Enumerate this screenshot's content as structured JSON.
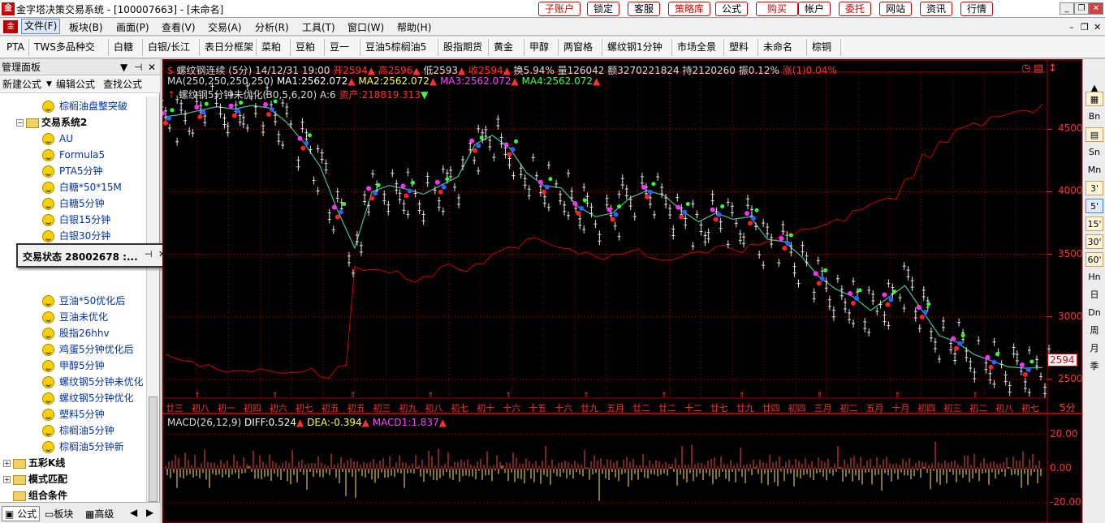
{
  "window": {
    "title": "金字塔决策交易系统 - [100007663] - [未命名]",
    "app_icon": "pyramid-logo-icon",
    "top_buttons": [
      "子账户",
      "锁定",
      "客服",
      "策略库",
      "公式",
      "购买",
      "帐户",
      "委托",
      "网站",
      "资讯",
      "行情"
    ],
    "red_buttons": [
      "子账户",
      "策略库",
      "购买",
      "委托"
    ]
  },
  "menu": {
    "items": [
      "文件(F)",
      "板块(B)",
      "画面(P)",
      "查看(V)",
      "交易(A)",
      "分析(R)",
      "工具(T)",
      "窗口(W)",
      "帮助(H)"
    ]
  },
  "tabs": [
    "PTA",
    "TWS多品种交",
    "白糖",
    "白银/长江",
    "表日分框架",
    "菜粕",
    "豆粕",
    "豆一",
    "豆油5棕榈油5",
    "股指期货",
    "黄金",
    "甲醇",
    "两窗格",
    "螺纹钢1分钟",
    "市场全景",
    "塑料",
    "未命名",
    "棕铜"
  ],
  "left_panel": {
    "title": "管理面板",
    "tools": [
      "新建公式",
      "编辑公式",
      "查找公式"
    ],
    "tree": [
      {
        "label": "棕榈油盘整突破",
        "type": "formula"
      },
      {
        "label": "交易系统2",
        "type": "folder"
      },
      {
        "label": "AU",
        "type": "formula"
      },
      {
        "label": "Formula5",
        "type": "formula"
      },
      {
        "label": "PTA5分钟",
        "type": "formula"
      },
      {
        "label": "白糖*50*15M",
        "type": "formula"
      },
      {
        "label": "白糖5分钟",
        "type": "formula"
      },
      {
        "label": "白银15分钟",
        "type": "formula"
      },
      {
        "label": "白银30分钟",
        "type": "formula"
      },
      {
        "label": "豆油*50优化后",
        "type": "formula"
      },
      {
        "label": "豆油未优化",
        "type": "formula"
      },
      {
        "label": "股指26hhv",
        "type": "formula"
      },
      {
        "label": "鸡蛋5分钟优化后",
        "type": "formula"
      },
      {
        "label": "甲醇5分钟",
        "type": "formula"
      },
      {
        "label": "螺纹钢5分钟未优化",
        "type": "formula"
      },
      {
        "label": "螺纹钢5分钟优化",
        "type": "formula"
      },
      {
        "label": "塑料5分钟",
        "type": "formula"
      },
      {
        "label": "棕榈油5分钟",
        "type": "formula"
      },
      {
        "label": "棕榈油5分钟新",
        "type": "formula"
      },
      {
        "label": "五彩K线",
        "type": "folder"
      },
      {
        "label": "模式匹配",
        "type": "folder"
      },
      {
        "label": "组合条件",
        "type": "folder"
      }
    ],
    "float_panel": "交易状态 28002678 :...",
    "bottom_tabs": [
      "公式",
      "板块",
      "高级"
    ]
  },
  "chart_header": {
    "line1": {
      "symbol": "螺纹钢连续 (5分)",
      "datetime": "14/12/31 19:00",
      "open": "开2594",
      "high": "高2596",
      "low": "低2593",
      "close": "收2594",
      "turnover": "换5.94%",
      "volume": "量126042",
      "amount": "额3270221824",
      "position": "持2120260",
      "amplitude": "振0.12%",
      "change": "涨(1)0.04%"
    },
    "line2": {
      "ma": "MA(250,250,250,250)",
      "ma1": "MA1:2562.072",
      "ma2": "MA2:2562.072",
      "ma3": "MA3:2562.072",
      "ma4": "MA4:2562.072"
    },
    "line3": {
      "system": "螺纹钢5分钟未优化(30,5,6,20)",
      "a": "A:6",
      "asset": "资产:218819.313"
    }
  },
  "macd_header": {
    "name": "MACD(26,12,9)",
    "diff": "DIFF:0.524",
    "dea": "DEA:-0.394",
    "macd1": "MACD1:1.837"
  },
  "price_axis": [
    "4500",
    "4000",
    "3500",
    "3000",
    "2500"
  ],
  "macd_axis": [
    "20.00",
    "0.00",
    "-20.00"
  ],
  "current_price": "2594",
  "bottom_right_label": "5分",
  "date_labels": [
    "廿三",
    "初八",
    "初一",
    "初四",
    "初六",
    "初七",
    "初五",
    "初五",
    "初三",
    "初九",
    "初八",
    "初七",
    "初十",
    "十六",
    "十五",
    "十六",
    "廿九",
    "五月",
    "廿二",
    "廿二",
    "十二",
    "廿七",
    "廿九",
    "廿四",
    "初四",
    "三月",
    "初二",
    "五月",
    "十月",
    "初四",
    "初三",
    "初二",
    "初八",
    "初七"
  ],
  "chart_colors": {
    "background": "#000000",
    "asset_line": "#cc0000",
    "candles": "#e0e0e0",
    "macd_yellow": "#ffee55",
    "macd_cyan": "#66e0e0",
    "macd_red": "#ff4444",
    "grid": "#aa0000"
  },
  "chart_data": [
    {
      "type": "line",
      "title": "螺纹钢连续 (5分)",
      "series": [
        {
          "name": "螺纹钢连续 (5分)",
          "values": [
            4600,
            4620,
            4650,
            4680,
            4660,
            4690,
            4670,
            4560,
            4400,
            4200,
            3850,
            3550,
            4000,
            4050,
            4020,
            3980,
            4050,
            4120,
            4380,
            4450,
            4350,
            4150,
            4050,
            4030,
            3880,
            3800,
            3830,
            3950,
            4010,
            3970,
            3850,
            3760,
            3830,
            3780,
            3800,
            3620,
            3600,
            3480,
            3320,
            3220,
            3160,
            3050,
            3150,
            3250,
            3050,
            2850,
            2800,
            2700,
            2650,
            2600,
            2590,
            2594
          ]
        },
        {
          "name": "资产",
          "values": [
            2700,
            2650,
            2600,
            2580,
            2570,
            2560,
            2570,
            2550,
            2560,
            2520,
            2600,
            3400,
            3380,
            3350,
            3300,
            3320,
            3400,
            3380,
            3420,
            3500,
            3560,
            3620,
            3600,
            3550,
            3500,
            3480,
            3500,
            3520,
            3480,
            3450,
            3480,
            3520,
            3560,
            3540,
            3580,
            3600,
            3680,
            3700,
            3720,
            3780,
            3850,
            3900,
            3950,
            4100,
            4300,
            4400,
            4500,
            4550,
            4600,
            4620,
            4650,
            4700
          ]
        }
      ],
      "ylim": [
        2350,
        4800
      ]
    },
    {
      "type": "bar",
      "title": "MACD(26,12,9)",
      "series": [
        {
          "name": "MACD1",
          "values": [
            5,
            -8,
            12,
            -15,
            9,
            -6,
            18,
            -20,
            14,
            -10,
            7,
            -12,
            16,
            -18,
            10,
            -5,
            8,
            -9,
            11,
            -14,
            6,
            -7,
            9,
            -11,
            13,
            -16,
            15,
            -12,
            8,
            -10,
            12,
            -8,
            6,
            -9,
            10,
            -13,
            7,
            -6,
            11,
            -10,
            9,
            -7,
            14,
            -12,
            8,
            -9,
            6,
            -5,
            9,
            -8,
            15,
            2
          ]
        }
      ],
      "ylim": [
        -27,
        27
      ]
    }
  ],
  "right_bar": [
    "Bn",
    "Sn",
    "Mn",
    "3'",
    "5'",
    "15'",
    "30'",
    "60'",
    "Hn",
    "日",
    "Dn",
    "周",
    "月",
    "季"
  ]
}
